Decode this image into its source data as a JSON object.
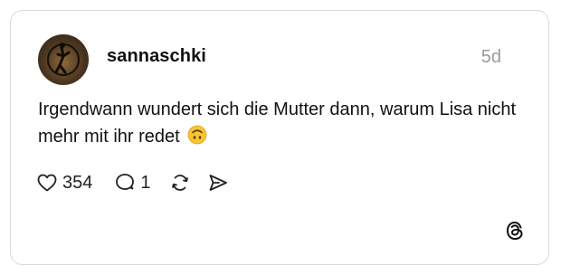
{
  "post": {
    "username": "sannaschki",
    "timestamp": "5d",
    "text": "Irgendwann wundert sich die Mutter dann, warum Lisa nicht mehr mit ihr redet",
    "emoji": "upside-down-face-emoji"
  },
  "actions": {
    "likes": "354",
    "replies": "1"
  },
  "icons": [
    "heart-icon",
    "comment-icon",
    "repost-icon",
    "share-icon",
    "threads-logo-icon"
  ],
  "colors": {
    "text": "#111111",
    "muted": "#9a9a9a",
    "border": "#d9d9d9",
    "emoji": "#f7c531"
  }
}
